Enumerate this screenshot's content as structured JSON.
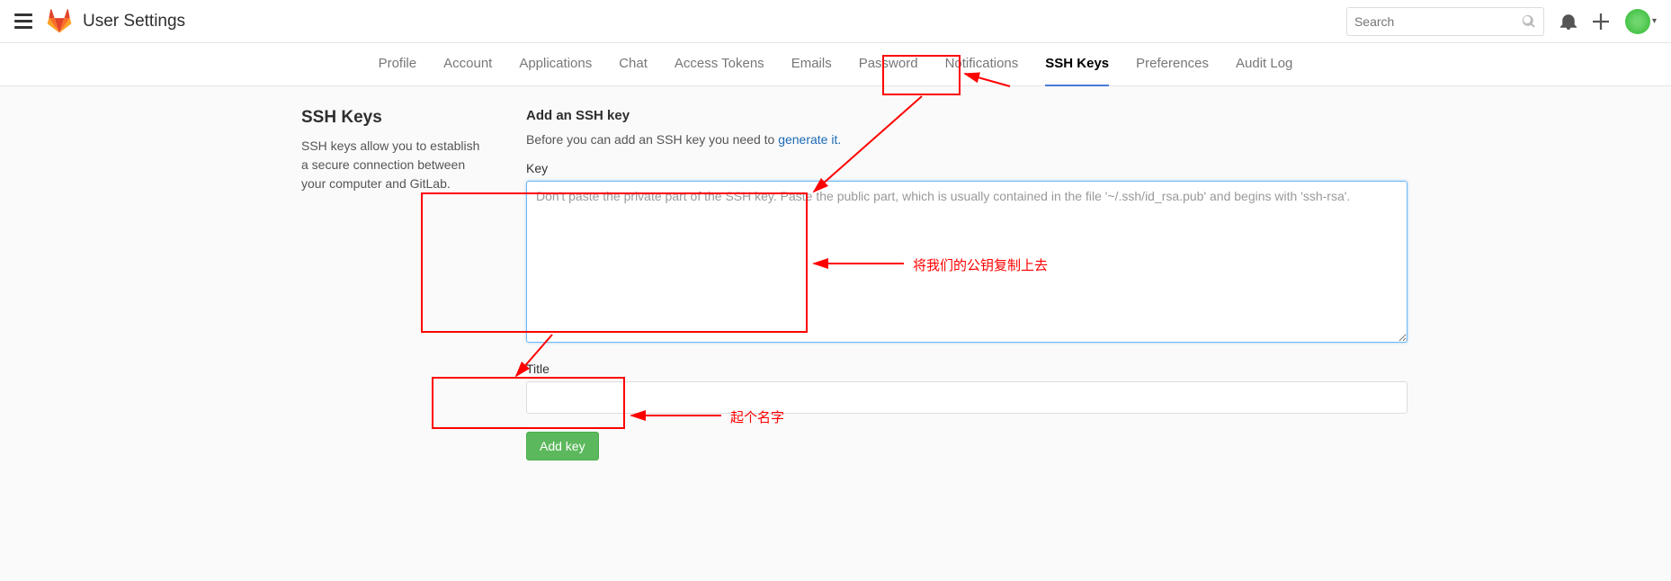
{
  "header": {
    "title": "User Settings",
    "search_placeholder": "Search"
  },
  "nav": {
    "tabs": [
      {
        "label": "Profile",
        "active": false
      },
      {
        "label": "Account",
        "active": false
      },
      {
        "label": "Applications",
        "active": false
      },
      {
        "label": "Chat",
        "active": false
      },
      {
        "label": "Access Tokens",
        "active": false
      },
      {
        "label": "Emails",
        "active": false
      },
      {
        "label": "Password",
        "active": false
      },
      {
        "label": "Notifications",
        "active": false
      },
      {
        "label": "SSH Keys",
        "active": true
      },
      {
        "label": "Preferences",
        "active": false
      },
      {
        "label": "Audit Log",
        "active": false
      }
    ]
  },
  "sidebar": {
    "heading": "SSH Keys",
    "description": "SSH keys allow you to establish a secure connection between your computer and GitLab."
  },
  "form": {
    "heading": "Add an SSH key",
    "intro_prefix": "Before you can add an SSH key you need to ",
    "intro_link": "generate it.",
    "key_label": "Key",
    "key_placeholder": "Don't paste the private part of the SSH key. Paste the public part, which is usually contained in the file '~/.ssh/id_rsa.pub' and begins with 'ssh-rsa'.",
    "title_label": "Title",
    "submit_label": "Add key"
  },
  "annotations": {
    "text1": "将我们的公钥复制上去",
    "text2": "起个名字"
  }
}
